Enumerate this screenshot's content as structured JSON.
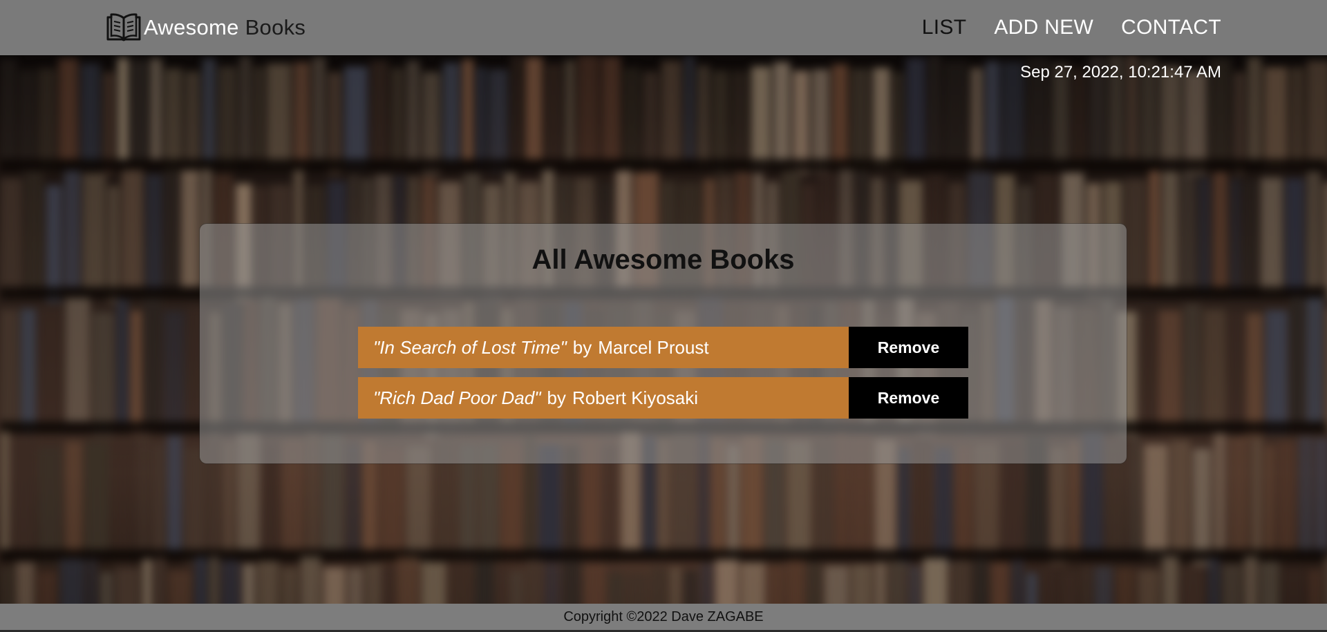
{
  "header": {
    "logo_word1": "Awesome",
    "logo_word2": "Books",
    "logo_icon": "open-book-icon",
    "nav": [
      {
        "label": "LIST",
        "active": true
      },
      {
        "label": "ADD NEW",
        "active": false
      },
      {
        "label": "CONTACT",
        "active": false
      }
    ]
  },
  "datetime": "Sep 27, 2022, 10:21:47 AM",
  "panel": {
    "title": "All Awesome Books",
    "books": [
      {
        "title": "\"In Search of Lost Time\"",
        "by": "by",
        "author": "Marcel Proust",
        "remove_label": "Remove"
      },
      {
        "title": "\"Rich Dad Poor Dad\"",
        "by": "by",
        "author": "Robert Kiyosaki",
        "remove_label": "Remove"
      }
    ]
  },
  "footer": {
    "copyright": "Copyright ©2022 Dave ZAGABE"
  },
  "colors": {
    "header_bg": "#7a7a7a",
    "book_row_bg": "#c07a31",
    "remove_button_bg": "#000000",
    "footer_bg": "#7d7d7d"
  }
}
